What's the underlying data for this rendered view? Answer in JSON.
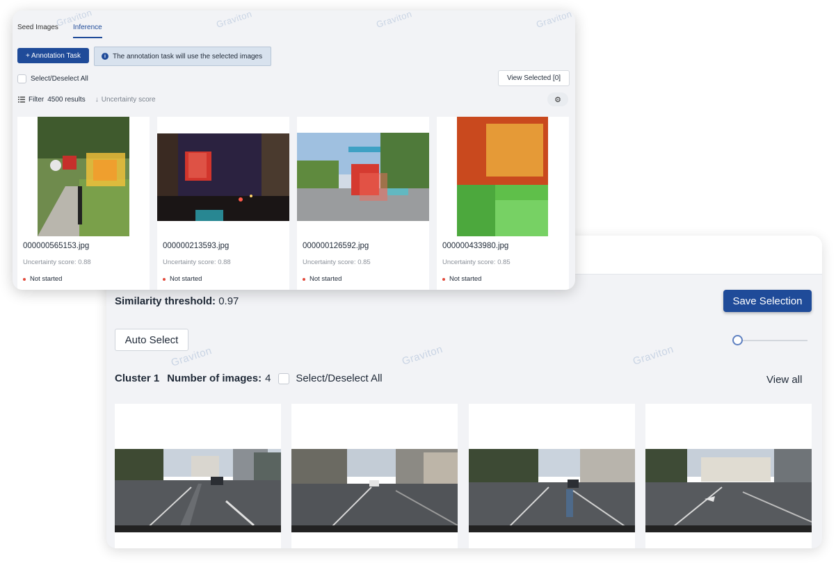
{
  "watermark": "Graviton",
  "inference": {
    "tabs": [
      {
        "label": "Seed Images"
      },
      {
        "label": "Inference"
      }
    ],
    "annotation_button": "+ Annotation Task",
    "info_text": "The annotation task will use the selected images",
    "select_all_label": "Select/Deselect All",
    "view_selected_label": "View Selected [0]",
    "filter_label": "Filter",
    "results_count": "4500 results",
    "sort_label": "Uncertainty score",
    "cards": [
      {
        "filename": "000000565153.jpg",
        "uncertainty": "Uncertainty score: 0.88",
        "status": "Not started"
      },
      {
        "filename": "000000213593.jpg",
        "uncertainty": "Uncertainty score: 0.88",
        "status": "Not started"
      },
      {
        "filename": "000000126592.jpg",
        "uncertainty": "Uncertainty score: 0.85",
        "status": "Not started"
      },
      {
        "filename": "000000433980.jpg",
        "uncertainty": "Uncertainty score: 0.85",
        "status": "Not started"
      }
    ],
    "icons": {
      "info": "info-icon",
      "filter": "list-filter-icon",
      "sort": "arrow-down-icon",
      "settings": "gear-icon"
    }
  },
  "similarity": {
    "threshold_label": "Similarity threshold:",
    "threshold_value": "0.97",
    "save_button": "Save Selection",
    "auto_select_button": "Auto Select",
    "slider_value": 0,
    "cluster_label": "Cluster 1",
    "num_images_label": "Number of images:",
    "num_images_value": "4",
    "select_all_label": "Select/Deselect All",
    "view_all_label": "View all"
  },
  "colors": {
    "primary": "#1f4b99",
    "status_dot": "#e24a3b",
    "panel_bg": "#f2f3f6"
  }
}
